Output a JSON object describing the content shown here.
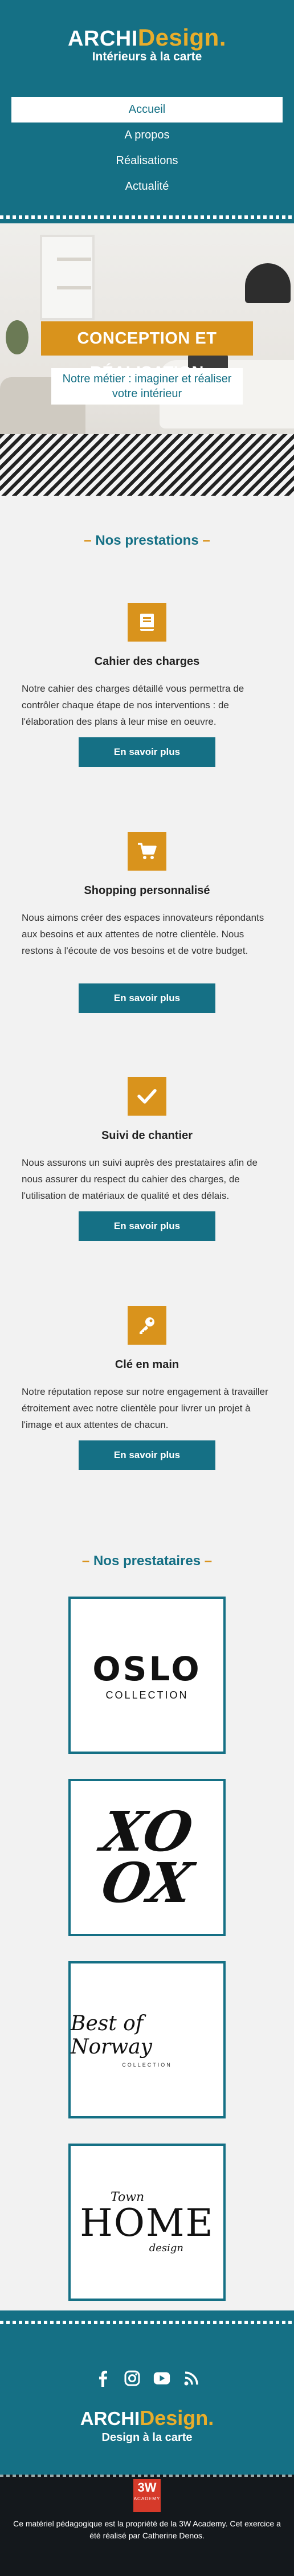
{
  "brand": {
    "logo_part1": "Archi",
    "logo_part2": "Design.",
    "tagline": "Intérieurs à la carte"
  },
  "nav": {
    "items": [
      {
        "label": "Accueil",
        "active": true
      },
      {
        "label": "A propos"
      },
      {
        "label": "Réalisations"
      },
      {
        "label": "Actualité"
      }
    ]
  },
  "hero": {
    "title": "CONCEPTION ET RÉALISATION",
    "subtitle_line1": "Notre métier : imaginer et réaliser",
    "subtitle_line2": "votre intérieur"
  },
  "prestations": {
    "title": "Nos prestations",
    "cards": [
      {
        "icon": "book-icon",
        "title": "Cahier des charges",
        "text": "Notre cahier des charges détaillé vous permettra de contrôler chaque étape de nos interventions : de l'élaboration des plans à leur mise en oeuvre.",
        "button": "En savoir plus"
      },
      {
        "icon": "shopping-cart-icon",
        "title": "Shopping personnalisé",
        "text": "Nous aimons créer des espaces innovateurs répondants aux besoins et aux attentes de notre clientèle. Nous restons à l'écoute de vos besoins et de votre budget.",
        "button": "En savoir plus"
      },
      {
        "icon": "check-icon",
        "title": "Suivi de chantier",
        "text": "Nous assurons un suivi auprès des prestataires afin de nous assurer du respect du cahier des charges, de l'utilisation de matériaux de qualité et des délais.",
        "button": "En savoir plus"
      },
      {
        "icon": "key-icon",
        "title": "Clé en main",
        "text": "Notre réputation repose sur notre engagement à travailler étroitement avec notre clientèle pour livrer un projet à l'image et aux attentes de chacun.",
        "button": "En savoir plus"
      }
    ]
  },
  "prestataires": {
    "title": "Nos prestataires",
    "logos": [
      {
        "name": "oslo-logo",
        "line1": "OSLO",
        "line2": "COLLECTION"
      },
      {
        "name": "xoxo-logo",
        "line1": "XO",
        "line2": "OX"
      },
      {
        "name": "best-of-norway-logo",
        "line1": "Best of Norway",
        "line2": "COLLECTION"
      },
      {
        "name": "town-home-design-logo",
        "line1": "Town",
        "line2": "HOME",
        "line3": "design"
      }
    ]
  },
  "footer": {
    "social": [
      "facebook-icon",
      "instagram-icon",
      "youtube-icon",
      "rss-icon"
    ],
    "logo_part1": "Archi",
    "logo_part2": "Design.",
    "tagline": "Design à la carte",
    "badge_line1": "3W",
    "badge_line2": "ACADEMY",
    "copyright": "Ce matériel pédagogique est la propriété de la 3W Academy. Cet exercice a été réalisé par Catherine Denos."
  },
  "colors": {
    "primary": "#157085",
    "accent": "#d9931c",
    "logo_accent": "#e8ad2b",
    "background": "#f2f2f2",
    "footer_dark": "#14181c"
  }
}
